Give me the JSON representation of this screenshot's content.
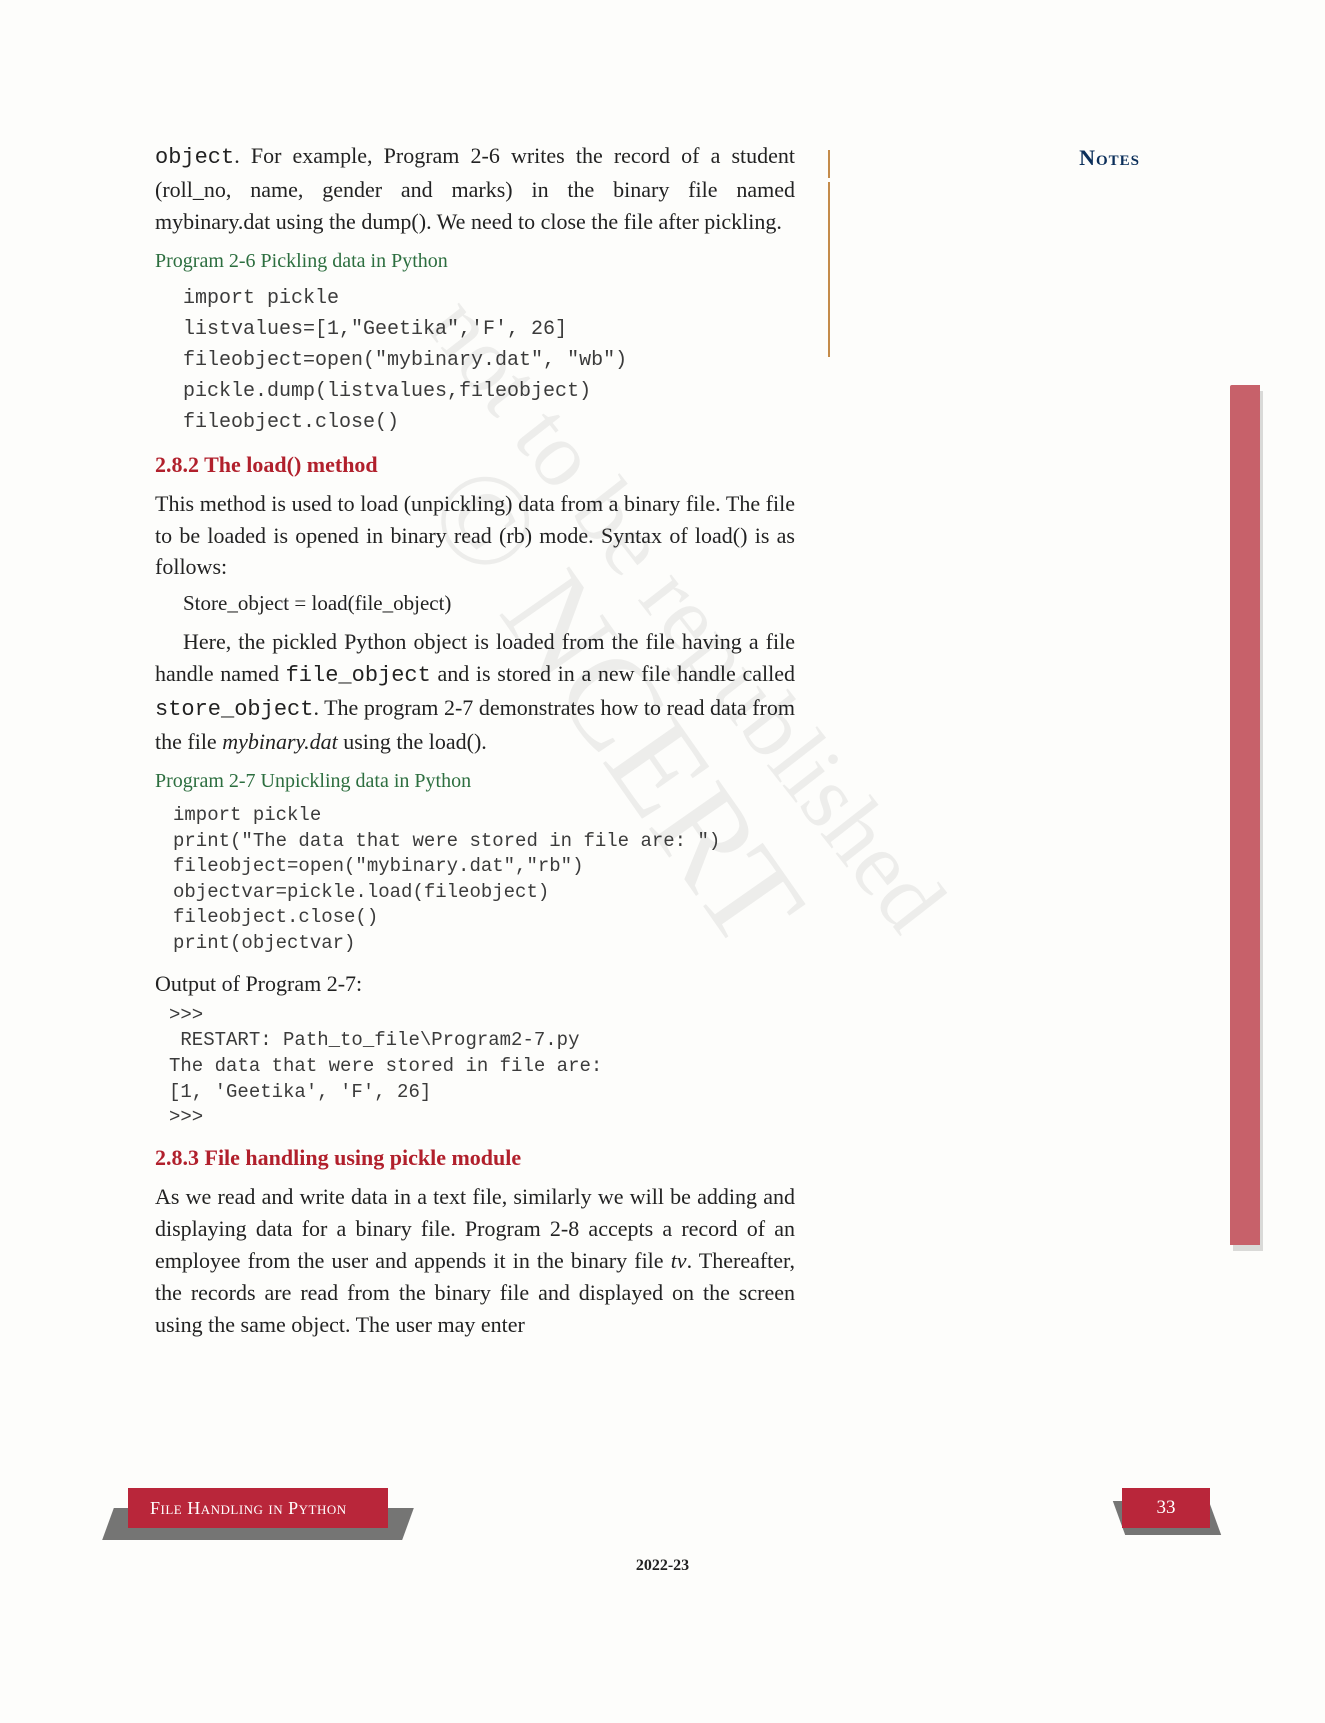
{
  "notes_label": "Notes",
  "para_intro_pre": "object",
  "para_intro": ". For example, Program 2-6 writes the record of a student (roll_no, name, gender and marks) in the binary file named mybinary.dat using the dump(). We need to close the file after pickling.",
  "program26_label": "Program 2-6    Pickling data in Python",
  "code26": "import pickle\nlistvalues=[1,\"Geetika\",'F', 26]\nfileobject=open(\"mybinary.dat\", \"wb\")\npickle.dump(listvalues,fileobject)\nfileobject.close()",
  "subhead282": "2.8.2 The load() method",
  "para282a": "This method is used to load (unpickling) data from a binary file. The file to be loaded is opened in binary read (rb) mode. Syntax of load() is as follows:",
  "syntax_load": "Store_object = load(file_object)",
  "para282b_pre": "Here, the pickled Python object is loaded from the file having a file handle named ",
  "para282b_code1": "file_object",
  "para282b_mid": " and is stored in a new file handle called ",
  "para282b_code2": "store_object",
  "para282b_post1": ". The program 2-7 demonstrates how to read data from the file ",
  "para282b_ital": "mybinary.dat",
  "para282b_post2": " using the load().",
  "program27_label": "Program 2-7    Unpickling data in Python",
  "code27": "import pickle\nprint(\"The data that were stored in file are: \")\nfileobject=open(\"mybinary.dat\",\"rb\")\nobjectvar=pickle.load(fileobject)\nfileobject.close()\nprint(objectvar)",
  "output27_label": "Output of Program 2-7:",
  "output27": ">>> \n RESTART: Path_to_file\\Program2-7.py \nThe data that were stored in file are: \n[1, 'Geetika', 'F', 26]\n>>>",
  "subhead283": "2.8.3 File handling using pickle module",
  "para283_pre": "As we read and write data in a text file, similarly we will be adding and displaying data for a binary file. Program 2-8 accepts a record of an employee from the user and appends it in the binary file ",
  "para283_ital": "tv",
  "para283_post": ". Thereafter, the records are read from the binary file and displayed on the screen using the same object. The user may enter",
  "footer_title": "File Handling in Python",
  "page_number": "33",
  "edition": "2022-23",
  "watermark1": "© NCERT",
  "watermark2": "not to be republished"
}
